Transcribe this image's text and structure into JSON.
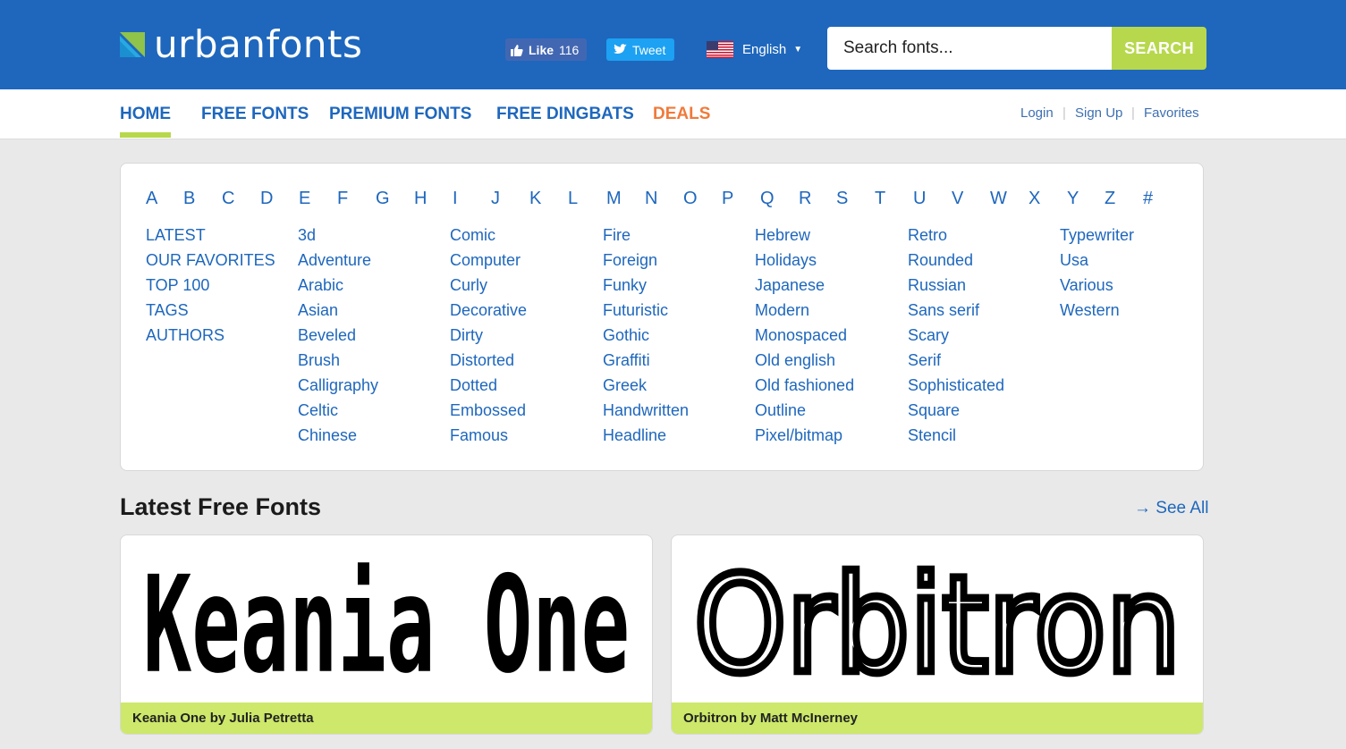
{
  "header": {
    "logo_text": "urbanfonts",
    "fb_like": {
      "label": "Like",
      "count": "116"
    },
    "tweet_label": "Tweet",
    "language": "English",
    "search": {
      "placeholder": "Search fonts...",
      "button": "SEARCH"
    }
  },
  "nav": {
    "items": [
      {
        "label": "HOME",
        "active": true
      },
      {
        "label": "FREE FONTS"
      },
      {
        "label": "PREMIUM FONTS"
      },
      {
        "label": "FREE DINGBATS"
      },
      {
        "label": "DEALS"
      }
    ],
    "util": [
      "Login",
      "Sign Up",
      "Favorites"
    ]
  },
  "alphabet": [
    "A",
    "B",
    "C",
    "D",
    "E",
    "F",
    "G",
    "H",
    "I",
    "J",
    "K",
    "L",
    "M",
    "N",
    "O",
    "P",
    "Q",
    "R",
    "S",
    "T",
    "U",
    "V",
    "W",
    "X",
    "Y",
    "Z",
    "#"
  ],
  "categories": {
    "col1": [
      "LATEST",
      "OUR FAVORITES",
      "TOP 100",
      "TAGS",
      "AUTHORS"
    ],
    "col2": [
      "3d",
      "Adventure",
      "Arabic",
      "Asian",
      "Beveled",
      "Brush",
      "Calligraphy",
      "Celtic",
      "Chinese"
    ],
    "col3": [
      "Comic",
      "Computer",
      "Curly",
      "Decorative",
      "Dirty",
      "Distorted",
      "Dotted",
      "Embossed",
      "Famous"
    ],
    "col4": [
      "Fire",
      "Foreign",
      "Funky",
      "Futuristic",
      "Gothic",
      "Graffiti",
      "Greek",
      "Handwritten",
      "Headline"
    ],
    "col5": [
      "Hebrew",
      "Holidays",
      "Japanese",
      "Modern",
      "Monospaced",
      "Old english",
      "Old fashioned",
      "Outline",
      "Pixel/bitmap"
    ],
    "col6": [
      "Retro",
      "Rounded",
      "Russian",
      "Sans serif",
      "Scary",
      "Serif",
      "Sophisticated",
      "Square",
      "Stencil"
    ],
    "col7": [
      "Typewriter",
      "Usa",
      "Various",
      "Western"
    ]
  },
  "latest": {
    "title": "Latest Free Fonts",
    "see_all": "→ See All",
    "cards": [
      {
        "preview_text": "Keania One",
        "caption": "Keania One by Julia Petretta"
      },
      {
        "preview_text": "Orbitron",
        "caption": "Orbitron by Matt McInerney"
      }
    ]
  },
  "colors": {
    "header_bg": "#1e67bd",
    "accent_green": "#b7d84c",
    "link_blue": "#1e67bd",
    "deals_orange": "#f07a3a",
    "caption_green": "#cde86a"
  }
}
